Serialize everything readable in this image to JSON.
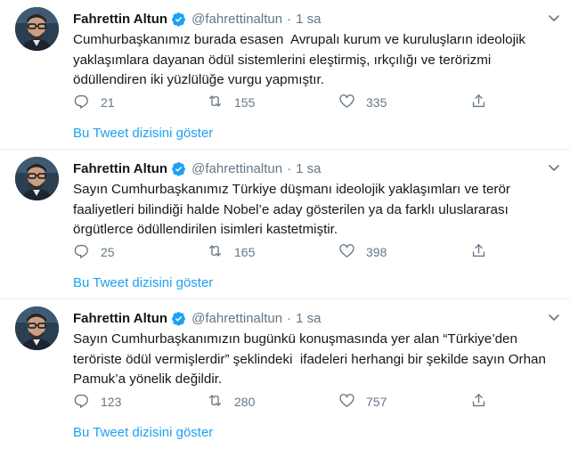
{
  "accent_color": "#1da1f2",
  "muted_color": "#657786",
  "icons": {
    "reply": "reply-icon",
    "retweet": "retweet-icon",
    "like": "heart-icon",
    "share": "share-icon",
    "verified": "verified-badge-icon",
    "more": "chevron-down-icon"
  },
  "tweets": [
    {
      "author_name": "Fahrettin Altun",
      "handle": "@fahrettinaltun",
      "separator": "·",
      "time": "1 sa",
      "text": "Cumhurbaşkanımız burada esasen  Avrupalı kurum ve kuruluşların ideolojik yaklaşımlara dayanan ödül sistemlerini eleştirmiş, ırkçılığı ve terörizmi ödüllendiren iki yüzlülüğe vurgu yapmıştır.",
      "replies": "21",
      "retweets": "155",
      "likes": "335",
      "thread_link": "Bu Tweet dizisini göster"
    },
    {
      "author_name": "Fahrettin Altun",
      "handle": "@fahrettinaltun",
      "separator": "·",
      "time": "1 sa",
      "text": "Sayın Cumhurbaşkanımız Türkiye düşmanı ideolojik yaklaşımları ve terör faaliyetleri bilindiği halde Nobel’e aday gösterilen ya da farklı uluslararası örgütlerce ödüllendirilen isimleri kastetmiştir.",
      "replies": "25",
      "retweets": "165",
      "likes": "398",
      "thread_link": "Bu Tweet dizisini göster"
    },
    {
      "author_name": "Fahrettin Altun",
      "handle": "@fahrettinaltun",
      "separator": "·",
      "time": "1 sa",
      "text": "Sayın Cumhurbaşkanımızın bugünkü konuşmasında yer alan “Türkiye’den teröriste ödül vermişlerdir” şeklindeki  ifadeleri herhangi bir şekilde sayın Orhan Pamuk’a yönelik değildir.",
      "replies": "123",
      "retweets": "280",
      "likes": "757",
      "thread_link": "Bu Tweet dizisini göster"
    }
  ]
}
